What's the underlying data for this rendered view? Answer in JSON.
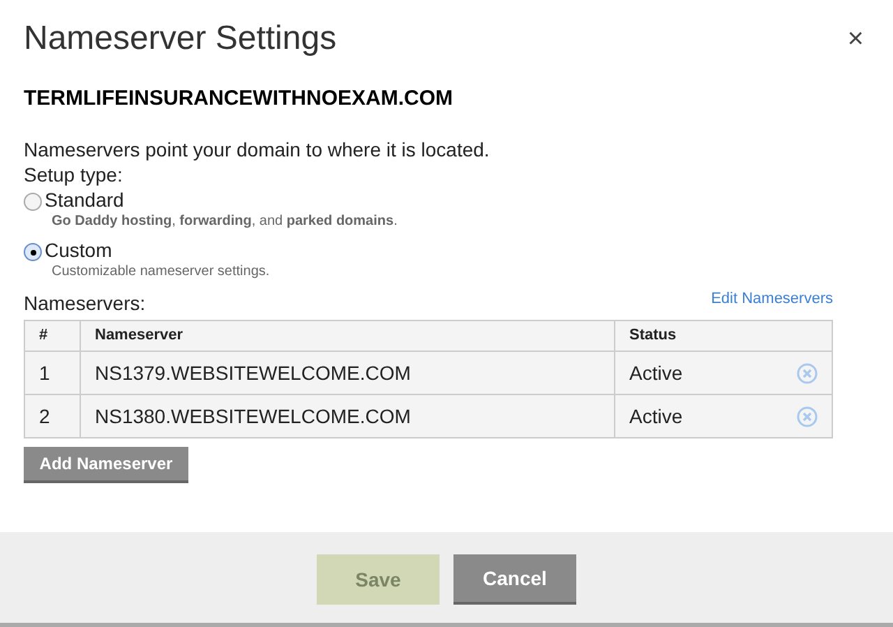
{
  "dialog": {
    "title": "Nameserver Settings",
    "close": "×"
  },
  "domain": "TERMLIFEINSURANCEWITHNOEXAM.COM",
  "intro": "Nameservers point your domain to where it is located.",
  "setup_label": "Setup type:",
  "setup_options": [
    {
      "label": "Standard",
      "description": "**Go Daddy hosting**, **forwarding**, and **parked domains**.",
      "selected": false
    },
    {
      "label": "Custom",
      "description": "Customizable nameserver settings.",
      "selected": true
    }
  ],
  "nameservers_label": "Nameservers:",
  "edit_link": "Edit Nameservers",
  "table": {
    "columns": [
      "#",
      "Nameserver",
      "Status"
    ],
    "rows": [
      {
        "index": "1",
        "nameserver": "NS1379.WEBSITEWELCOME.COM",
        "status": "Active"
      },
      {
        "index": "2",
        "nameserver": "NS1380.WEBSITEWELCOME.COM",
        "status": "Active"
      }
    ]
  },
  "add_button": "Add Nameserver",
  "footer_buttons": [
    {
      "label": "Save",
      "disabled": true
    },
    {
      "label": "Cancel",
      "disabled": false
    }
  ]
}
